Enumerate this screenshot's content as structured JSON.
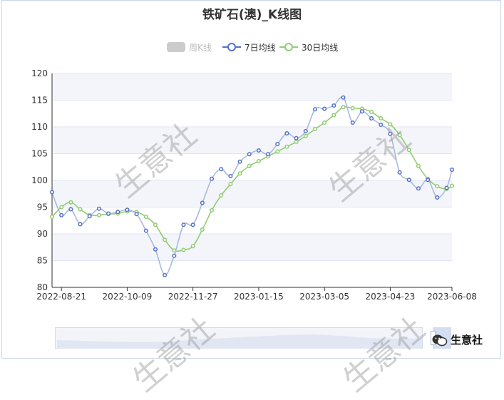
{
  "chart_data": {
    "type": "line",
    "title": "铁矿石(澳)_K线图",
    "legend": [
      "周K线",
      "7日均线",
      "30日均线"
    ],
    "legend_position": "top-center",
    "ylim": [
      80,
      120
    ],
    "yticks": [
      80,
      85,
      90,
      95,
      100,
      105,
      110,
      115,
      120
    ],
    "xlim": [
      "2022-08-14",
      "2023-06-08"
    ],
    "xticks": [
      "2022-08-21",
      "2022-10-09",
      "2022-11-27",
      "2023-01-15",
      "2023-03-05",
      "2023-04-23",
      "2023-06-08"
    ],
    "grid": true,
    "colors": {
      "ma7": "#5470c6",
      "ma7_line": "#a9b9df",
      "ma30": "#91cc75",
      "band": "#f3f5fa",
      "axis": "#333333",
      "grid": "#e0e6f1"
    },
    "series": [
      {
        "name": "7日均线",
        "values": [
          [
            "2022-08-14",
            97.8
          ],
          [
            "2022-08-21",
            93.5
          ],
          [
            "2022-08-28",
            94.6
          ],
          [
            "2022-09-04",
            91.8
          ],
          [
            "2022-09-11",
            93.3
          ],
          [
            "2022-09-18",
            94.7
          ],
          [
            "2022-09-25",
            93.8
          ],
          [
            "2022-10-02",
            94.1
          ],
          [
            "2022-10-09",
            94.5
          ],
          [
            "2022-10-16",
            93.7
          ],
          [
            "2022-10-23",
            90.6
          ],
          [
            "2022-10-30",
            87.1
          ],
          [
            "2022-11-06",
            82.3
          ],
          [
            "2022-11-13",
            85.9
          ],
          [
            "2022-11-20",
            91.7
          ],
          [
            "2022-11-27",
            91.7
          ],
          [
            "2022-12-04",
            95.8
          ],
          [
            "2022-12-11",
            100.3
          ],
          [
            "2022-12-18",
            102.1
          ],
          [
            "2022-12-25",
            100.8
          ],
          [
            "2023-01-01",
            103.5
          ],
          [
            "2023-01-08",
            104.9
          ],
          [
            "2023-01-15",
            105.6
          ],
          [
            "2023-01-22",
            104.9
          ],
          [
            "2023-01-29",
            106.8
          ],
          [
            "2023-02-05",
            108.8
          ],
          [
            "2023-02-12",
            107.9
          ],
          [
            "2023-02-19",
            109.2
          ],
          [
            "2023-02-26",
            113.3
          ],
          [
            "2023-03-05",
            113.4
          ],
          [
            "2023-03-12",
            114.0
          ],
          [
            "2023-03-19",
            115.5
          ],
          [
            "2023-03-26",
            110.8
          ],
          [
            "2023-04-02",
            112.9
          ],
          [
            "2023-04-09",
            111.6
          ],
          [
            "2023-04-16",
            110.4
          ],
          [
            "2023-04-23",
            108.7
          ],
          [
            "2023-04-30",
            101.5
          ],
          [
            "2023-05-07",
            100.1
          ],
          [
            "2023-05-14",
            98.5
          ],
          [
            "2023-05-21",
            100.1
          ],
          [
            "2023-05-28",
            96.8
          ],
          [
            "2023-06-04",
            98.6
          ],
          [
            "2023-06-08",
            102.0
          ]
        ]
      },
      {
        "name": "30日均线",
        "values": [
          [
            "2022-08-14",
            93.2
          ],
          [
            "2022-08-21",
            95.0
          ],
          [
            "2022-08-28",
            95.9
          ],
          [
            "2022-09-04",
            94.6
          ],
          [
            "2022-09-11",
            93.5
          ],
          [
            "2022-09-18",
            93.5
          ],
          [
            "2022-09-25",
            93.7
          ],
          [
            "2022-10-02",
            93.8
          ],
          [
            "2022-10-09",
            94.2
          ],
          [
            "2022-10-16",
            94.1
          ],
          [
            "2022-10-23",
            93.2
          ],
          [
            "2022-10-30",
            91.7
          ],
          [
            "2022-11-06",
            88.9
          ],
          [
            "2022-11-13",
            86.9
          ],
          [
            "2022-11-20",
            87.0
          ],
          [
            "2022-11-27",
            87.7
          ],
          [
            "2022-12-04",
            90.8
          ],
          [
            "2022-12-11",
            94.4
          ],
          [
            "2022-12-18",
            97.2
          ],
          [
            "2022-12-25",
            99.3
          ],
          [
            "2023-01-01",
            101.3
          ],
          [
            "2023-01-08",
            102.7
          ],
          [
            "2023-01-15",
            103.6
          ],
          [
            "2023-01-22",
            104.5
          ],
          [
            "2023-01-29",
            105.4
          ],
          [
            "2023-02-05",
            106.3
          ],
          [
            "2023-02-12",
            107.2
          ],
          [
            "2023-02-19",
            108.3
          ],
          [
            "2023-02-26",
            109.6
          ],
          [
            "2023-03-05",
            110.8
          ],
          [
            "2023-03-12",
            112.2
          ],
          [
            "2023-03-19",
            113.7
          ],
          [
            "2023-03-26",
            113.5
          ],
          [
            "2023-04-02",
            113.4
          ],
          [
            "2023-04-09",
            112.8
          ],
          [
            "2023-04-16",
            111.6
          ],
          [
            "2023-04-23",
            110.5
          ],
          [
            "2023-04-30",
            108.5
          ],
          [
            "2023-05-07",
            105.7
          ],
          [
            "2023-05-14",
            102.7
          ],
          [
            "2023-05-21",
            100.3
          ],
          [
            "2023-05-28",
            98.9
          ],
          [
            "2023-06-04",
            98.4
          ],
          [
            "2023-06-08",
            99.0
          ]
        ]
      }
    ]
  },
  "watermark": "生意社",
  "brand": {
    "name": "生意社",
    "icon": "wechat-icon"
  }
}
